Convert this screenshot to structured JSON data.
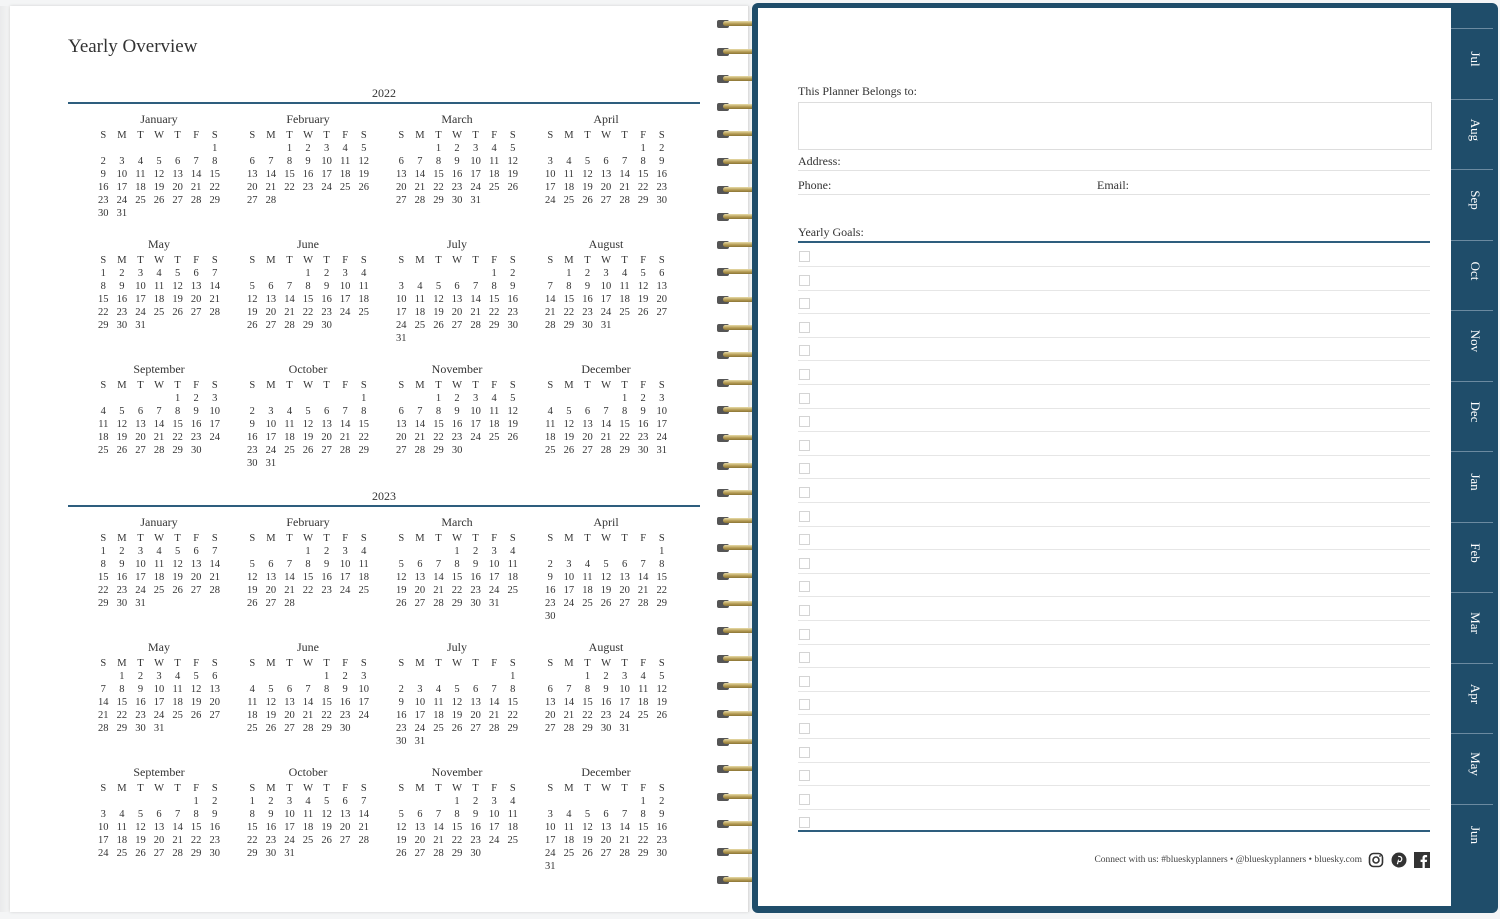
{
  "left_page": {
    "title": "Yearly Overview",
    "dow": [
      "S",
      "M",
      "T",
      "W",
      "T",
      "F",
      "S"
    ],
    "years": [
      {
        "label": "2022",
        "months": [
          {
            "name": "January",
            "start": 6,
            "days": 31
          },
          {
            "name": "February",
            "start": 2,
            "days": 28
          },
          {
            "name": "March",
            "start": 2,
            "days": 31
          },
          {
            "name": "April",
            "start": 5,
            "days": 30
          },
          {
            "name": "May",
            "start": 0,
            "days": 31
          },
          {
            "name": "June",
            "start": 3,
            "days": 30
          },
          {
            "name": "July",
            "start": 5,
            "days": 31
          },
          {
            "name": "August",
            "start": 1,
            "days": 31
          },
          {
            "name": "September",
            "start": 4,
            "days": 30
          },
          {
            "name": "October",
            "start": 6,
            "days": 31
          },
          {
            "name": "November",
            "start": 2,
            "days": 30
          },
          {
            "name": "December",
            "start": 4,
            "days": 31
          }
        ]
      },
      {
        "label": "2023",
        "months": [
          {
            "name": "January",
            "start": 0,
            "days": 31
          },
          {
            "name": "February",
            "start": 3,
            "days": 28
          },
          {
            "name": "March",
            "start": 3,
            "days": 31
          },
          {
            "name": "April",
            "start": 6,
            "days": 30
          },
          {
            "name": "May",
            "start": 1,
            "days": 31
          },
          {
            "name": "June",
            "start": 4,
            "days": 30
          },
          {
            "name": "July",
            "start": 6,
            "days": 31
          },
          {
            "name": "August",
            "start": 2,
            "days": 31
          },
          {
            "name": "September",
            "start": 5,
            "days": 30
          },
          {
            "name": "October",
            "start": 0,
            "days": 31
          },
          {
            "name": "November",
            "start": 3,
            "days": 30
          },
          {
            "name": "December",
            "start": 5,
            "days": 31
          }
        ]
      }
    ]
  },
  "right_page": {
    "belongs_label": "This Planner Belongs to:",
    "address_label": "Address:",
    "phone_label": "Phone:",
    "email_label": "Email:",
    "goals_label": "Yearly Goals:",
    "footer": "Connect with us: #blueskyplanners • @blueskyplanners • bluesky.com",
    "social_icons": [
      "instagram-icon",
      "pinterest-icon",
      "facebook-icon"
    ]
  },
  "tabs": [
    "Jul",
    "Aug",
    "Sep",
    "Oct",
    "Nov",
    "Dec",
    "Jan",
    "Feb",
    "Mar",
    "Apr",
    "May",
    "Jun"
  ],
  "colors": {
    "accent": "#2e5e7e",
    "cover": "#1f4d6a",
    "wire": "#b59c55"
  }
}
